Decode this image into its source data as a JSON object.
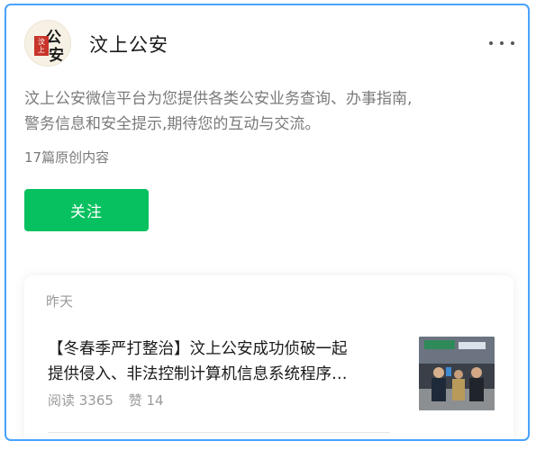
{
  "account": {
    "name": "汶上公安",
    "avatar_logo_text": "汶上公安",
    "avatar_seal_text": "汶上"
  },
  "header": {
    "more_icon": "more-dots-icon"
  },
  "profile": {
    "description_line1": "汶上公安微信平台为您提供各类公安业务查询、办事指南,",
    "description_line2": "警务信息和安全提示,期待您的互动与交流。",
    "article_count": "17篇原创内容",
    "follow_label": "关注"
  },
  "feed": {
    "date": "昨天",
    "articles": [
      {
        "title_line1": "【冬春季严打整治】汶上公安成功侦破一起",
        "title_line2": "提供侵入、非法控制计算机信息系统程序…",
        "reads": "阅读 3365",
        "likes": "赞 14"
      }
    ]
  },
  "colors": {
    "accent_border": "#47a3ff",
    "follow_button": "#07c160",
    "seal_red": "#c8342a"
  }
}
